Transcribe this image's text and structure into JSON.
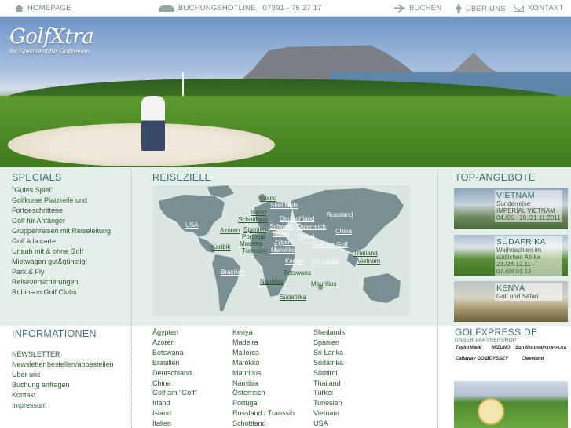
{
  "topbar": {
    "home": "HOMEPAGE",
    "hotline_label": "BUCHUNGSHOTLINE",
    "hotline_number": "07391 - 75 27 17",
    "buchen": "BUCHEN",
    "ueber_uns": "ÜBER UNS",
    "kontakt": "KONTAKT"
  },
  "logo": {
    "name": "GolfXtra",
    "tagline": "Ihr Spezialist für Golfreisen"
  },
  "specials": {
    "title": "SPECIALS",
    "items": [
      "\"Gutes Spiel\"",
      "Golfkurse Platzreife und",
      "Fortgeschrittene",
      "Golf für Anfänger",
      "Gruppenreisen mit Reiseleitung",
      "Golf à la carte",
      "Urlaub mit & ohne Golf",
      "Mietwagen gut&günstig!",
      "Park & Fly",
      "Reiseversicherungen",
      "Robinson Golf Clubs"
    ]
  },
  "reiseziele": {
    "title": "REISEZIELE",
    "map_labels": [
      "Island",
      "Shetlands",
      "Irland",
      "Schottland",
      "Deutschland",
      "Russland",
      "USA",
      "Azoren",
      "Spanien",
      "Schweiz",
      "Österreich",
      "Italien",
      "China",
      "Türkei",
      "Portugal",
      "Madeira",
      "Zypern",
      "Karibik",
      "Tunesien",
      "Marokko",
      "Golf am Golf",
      "Thailand",
      "Vietnam",
      "Kenya",
      "Sri Lanka",
      "Brasilien",
      "Botswana",
      "Namibia",
      "Mauritius",
      "Südafrika"
    ]
  },
  "angebote": {
    "title": "TOP-ANGEBOTE",
    "offers": [
      {
        "title": "VIETNAM",
        "desc": "Sonderreise IMPERIAL VIETNAM 04./05.- 20./21.11.2011"
      },
      {
        "title": "SÜDAFRIKA",
        "desc": "Weihnachten im südlichen Afrika 23./24.12.11 - 07./08.01.12"
      },
      {
        "title": "KENYA",
        "desc": "Golf und Safari"
      }
    ]
  },
  "informationen": {
    "title": "INFORMATIONEN",
    "items": [
      "NEWSLETTER",
      "Newsletter bestellen/abbestellen",
      "Über uns",
      "Buchung anfragen",
      "Kontakt",
      "Impressum"
    ]
  },
  "destinations": {
    "col1": [
      "Ägypten",
      "Azoren",
      "Botswana",
      "Brasilien",
      "Deutschland",
      "China",
      "Golf am \"Golf\"",
      "Irland",
      "Island",
      "Italien"
    ],
    "col2": [
      "Kenya",
      "Madeira",
      "Mallorca",
      "Marokko",
      "Mauritius",
      "Namibia",
      "Österreich",
      "Portugal",
      "Russland / Transsib",
      "Schottland"
    ],
    "col3": [
      "Shetlands",
      "Spanien",
      "Sri Lanka",
      "Südafrika",
      "Südtirol",
      "Thailand",
      "Türkei",
      "Tunesien",
      "Vietnam",
      "USA"
    ]
  },
  "partner": {
    "title": "GOLFXPRESS.DE",
    "subtitle": "UNSER PARTNERSHOP",
    "brands": [
      "TaylorMade",
      "MIZUNO",
      "Sun Mountain",
      "TOP FLITE",
      "Callaway GOLF",
      "ODYSSEY",
      "Cleveland"
    ]
  }
}
